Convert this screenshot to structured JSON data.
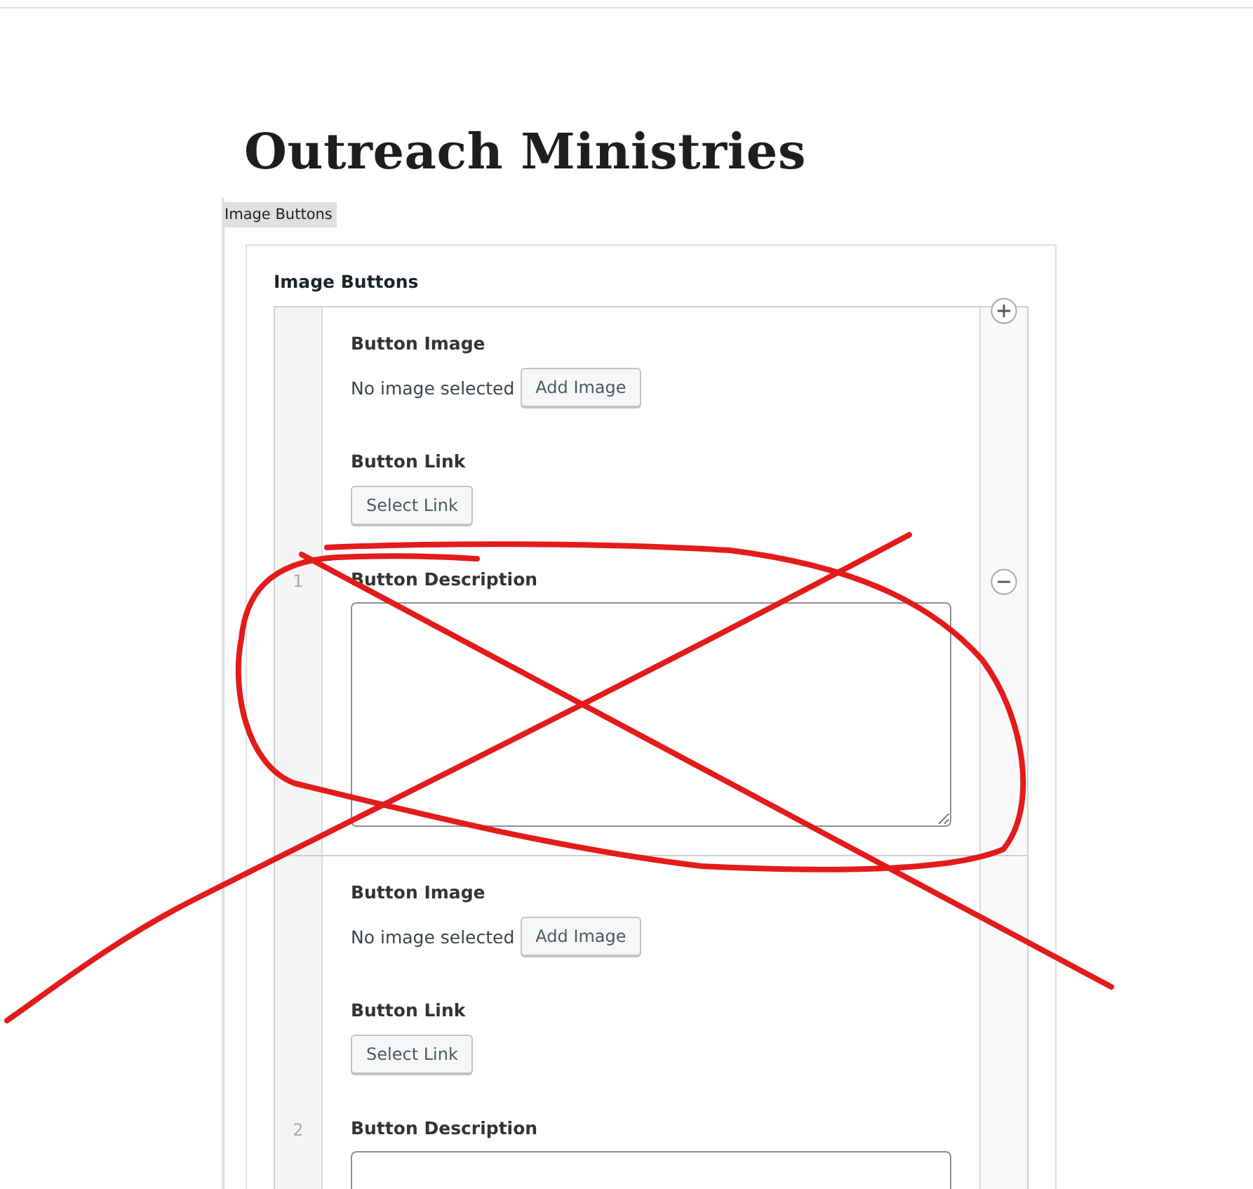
{
  "page_title": "Outreach Ministries",
  "block_label": "Image Buttons",
  "field_label": "Image Buttons",
  "rows": [
    {
      "number": "1",
      "controls_shown": true,
      "image_label": "Button Image",
      "image_status": "No image selected",
      "add_image_button": "Add Image",
      "link_label": "Button Link",
      "select_link_button": "Select Link",
      "description_label": "Button Description"
    },
    {
      "number": "2",
      "controls_shown": false,
      "image_label": "Button Image",
      "image_status": "No image selected",
      "add_image_button": "Add Image",
      "link_label": "Button Link",
      "select_link_button": "Select Link",
      "description_label": "Button Description"
    }
  ],
  "annotation": {
    "kind": "cross-out"
  }
}
